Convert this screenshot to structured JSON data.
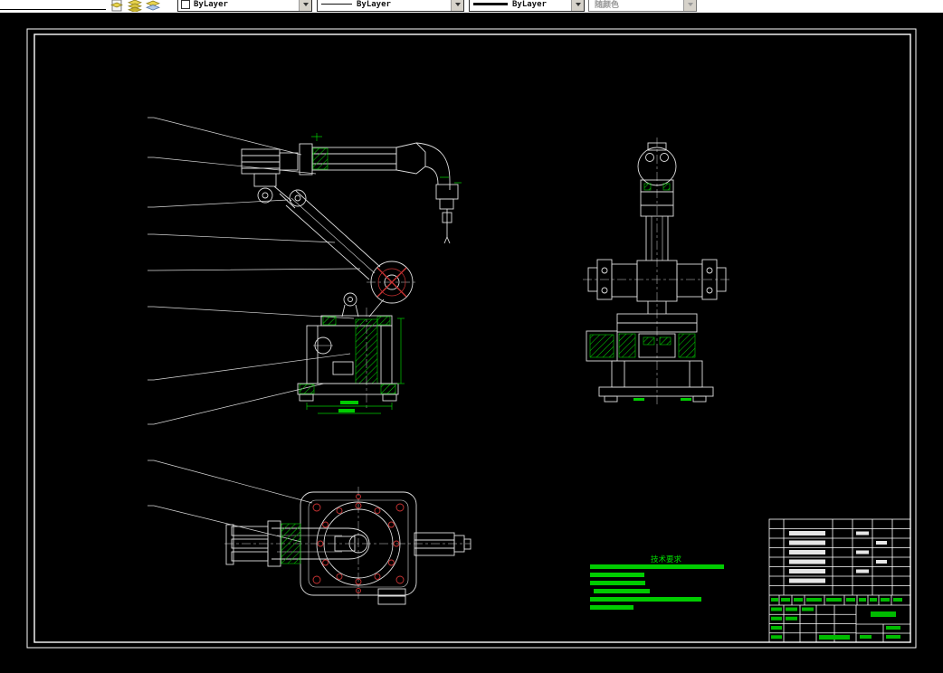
{
  "toolbar": {
    "color_combo": {
      "value": "ByLayer"
    },
    "linetype_combo": {
      "value": "ByLayer"
    },
    "lineweight_combo": {
      "value": "ByLayer"
    },
    "plot_style_combo": {
      "value": "随颜色",
      "disabled": true
    },
    "icons": [
      "layer-properties-manager-icon",
      "make-layer-current-icon",
      "layer-previous-icon"
    ]
  },
  "drawing": {
    "tech_requirements_title": "技术要求",
    "views": [
      "front-view",
      "side-view",
      "top-view"
    ],
    "frame_color": "#ffffff",
    "line_color": "#dedede",
    "accent_green": "#00cc00",
    "accent_red": "#cc3333",
    "background": "#000000"
  }
}
